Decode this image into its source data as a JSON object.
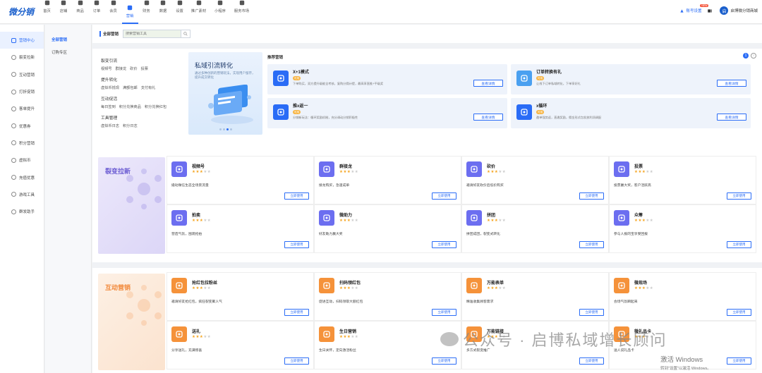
{
  "app": {
    "logo": "微分销"
  },
  "nav": [
    {
      "label": "首页",
      "icon": "home-icon"
    },
    {
      "label": "店铺",
      "icon": "store-icon"
    },
    {
      "label": "商品",
      "icon": "goods-icon"
    },
    {
      "label": "订单",
      "icon": "order-icon"
    },
    {
      "label": "会员",
      "icon": "member-icon"
    },
    {
      "label": "营销",
      "icon": "marketing-icon",
      "active": true
    },
    {
      "label": "财务",
      "icon": "finance-icon"
    },
    {
      "label": "数据",
      "icon": "data-icon"
    },
    {
      "label": "设置",
      "icon": "settings-icon"
    },
    {
      "label": "推广素材",
      "icon": "share-icon"
    },
    {
      "label": "小程序",
      "icon": "miniprogram-icon"
    },
    {
      "label": "服务市场",
      "icon": "service-market-icon"
    }
  ],
  "topright": {
    "settings_label": "账号设置",
    "new_badge": "NEW",
    "shop_name": "启博微分销商城",
    "shop_avatar": "启"
  },
  "sidebar": [
    {
      "label": "营销中心",
      "active": true
    },
    {
      "label": "裂变拉新"
    },
    {
      "label": "互动营销"
    },
    {
      "label": "打折促销"
    },
    {
      "label": "客单提升"
    },
    {
      "label": "优惠券"
    },
    {
      "label": "积分营销"
    },
    {
      "label": "虚拟币"
    },
    {
      "label": "充值优惠"
    },
    {
      "label": "游戏工具"
    },
    {
      "label": "群发助手"
    }
  ],
  "subsidebar": [
    {
      "label": "全部营销",
      "active": true
    },
    {
      "label": "订购专区"
    }
  ],
  "tabbar": {
    "title": "全部营销",
    "search_placeholder": "搜索营销工具"
  },
  "categories": [
    {
      "heading": "裂变引流",
      "items": [
        "视频号",
        "群接龙",
        "砍价",
        "投票"
      ]
    },
    {
      "heading": "提升转化",
      "items": [
        "虚拟币抵现",
        "满额包邮",
        "支付有礼"
      ]
    },
    {
      "heading": "互动促活",
      "items": [
        "每日签到",
        "积分兑换商品",
        "积分兑换红包"
      ]
    },
    {
      "heading": "工具管理",
      "items": [
        "虚拟币日志",
        "积分日志"
      ]
    }
  ],
  "banner": {
    "title": "私域引流转化",
    "desc": "通过多种创新的营销玩法，实现用户留存，提升成交转化"
  },
  "recommend": {
    "title": "推荐营销",
    "page": "1",
    "items": [
      {
        "title": "X+1模式",
        "badge": "可用",
        "desc": "下单购买，双方提升级能全考核，复购分佣计提，最高享直推+平级奖",
        "button": "查看详情",
        "color": "#2a6cf6",
        "icon": "x1-icon"
      },
      {
        "title": "订单转换有礼",
        "badge": "可用",
        "desc": "让线下订单私域转化，下单享好礼",
        "button": "查看详情",
        "color": "#4aa0f0",
        "icon": "phone-order-icon"
      },
      {
        "title": "推x返一",
        "badge": "可用",
        "desc": "分销新玩法：循环奖励机制，充分调动分销积极性",
        "button": "查看详情",
        "color": "#2a6cf6",
        "icon": "refer-icon"
      },
      {
        "title": "x循环",
        "badge": "可用",
        "desc": "邀单强势返，直邀奖励，佣金形式包发放利润调配",
        "button": "查看详情",
        "color": "#2a6cf6",
        "icon": "cycle-icon"
      }
    ]
  },
  "sections": [
    {
      "title": "裂变拉新",
      "title_color": "#6c5dd3",
      "bg": "linear-gradient(135deg,#ece8fb,#dcd6f7)",
      "cards": [
        {
          "title": "视频号",
          "stars": 3,
          "desc": "撬动微信生态全场景流量",
          "button": "立即使用",
          "color": "#6c6ef0",
          "icon": "video-channel-icon"
        },
        {
          "title": "群接龙",
          "stars": 3,
          "desc": "接龙购买，急速成单",
          "button": "立即使用",
          "color": "#6c6ef0",
          "icon": "group-chain-icon"
        },
        {
          "title": "砍价",
          "stars": 3,
          "desc": "邀请好友砍价后低价购买",
          "button": "立即使用",
          "color": "#6c6ef0",
          "icon": "bargain-icon"
        },
        {
          "title": "投票",
          "stars": 3,
          "desc": "投票赢大奖，客户活跃高",
          "button": "立即使用",
          "color": "#6c6ef0",
          "icon": "vote-icon"
        },
        {
          "title": "拍卖",
          "stars": 3,
          "desc": "营造气氛，围观抢拍",
          "button": "立即使用",
          "color": "#6c6ef0",
          "icon": "auction-icon"
        },
        {
          "title": "微助力",
          "stars": 3,
          "desc": "好友助力赢大奖",
          "button": "立即使用",
          "color": "#6c6ef0",
          "icon": "assist-icon"
        },
        {
          "title": "拼团",
          "stars": 3,
          "desc": "拼团成团，裂变式转化",
          "button": "立即使用",
          "color": "#6c6ef0",
          "icon": "group-buy-icon"
        },
        {
          "title": "众筹",
          "stars": 3,
          "desc": "参与人报的宝享受回报",
          "button": "立即使用",
          "color": "#6c6ef0",
          "icon": "crowdfund-icon"
        }
      ]
    },
    {
      "title": "互动营销",
      "title_color": "#f28a3c",
      "bg": "linear-gradient(135deg,#fdf0e4,#fbe3cf)",
      "cards": [
        {
          "title": "抢红包拉粉丝",
          "stars": 3,
          "desc": "邀请好友抢红包，疯狂裂变聚人气",
          "button": "立即使用",
          "color": "#f5923a",
          "icon": "red-packet-icon"
        },
        {
          "title": "扫码领红包",
          "stars": 3,
          "desc": "促进互动，扫码领取大额红包",
          "button": "立即使用",
          "color": "#f5923a",
          "icon": "scan-icon"
        },
        {
          "title": "万能表单",
          "stars": 3,
          "desc": "精准收集顾客需求",
          "button": "立即使用",
          "color": "#f5923a",
          "icon": "form-icon"
        },
        {
          "title": "微现场",
          "stars": 3,
          "desc": "会场气氛瞬起来",
          "button": "立即使用",
          "color": "#f5923a",
          "icon": "live-scene-icon"
        },
        {
          "title": "送礼",
          "stars": 3,
          "desc": "分享送礼，充满惊喜",
          "button": "立即使用",
          "color": "#f5923a",
          "icon": "gift-icon"
        },
        {
          "title": "生日营销",
          "stars": 3,
          "desc": "生日关怀，定向激活粉丝",
          "button": "立即使用",
          "color": "#f5923a",
          "icon": "birthday-icon"
        },
        {
          "title": "万能链接",
          "stars": 3,
          "desc": "多方式裂变推广",
          "button": "立即使用",
          "color": "#f5923a",
          "icon": "link-icon"
        },
        {
          "title": "微礼品卡",
          "stars": 3,
          "desc": "送人说礼品卡",
          "button": "立即使用",
          "color": "#f5923a",
          "icon": "gift-card-icon"
        }
      ]
    }
  ],
  "watermark": {
    "text": "公众号 · 启博私域增长顾问"
  },
  "activation": {
    "line1": "激活 Windows",
    "line2": "转到\"设置\"以激活 Windows。"
  }
}
